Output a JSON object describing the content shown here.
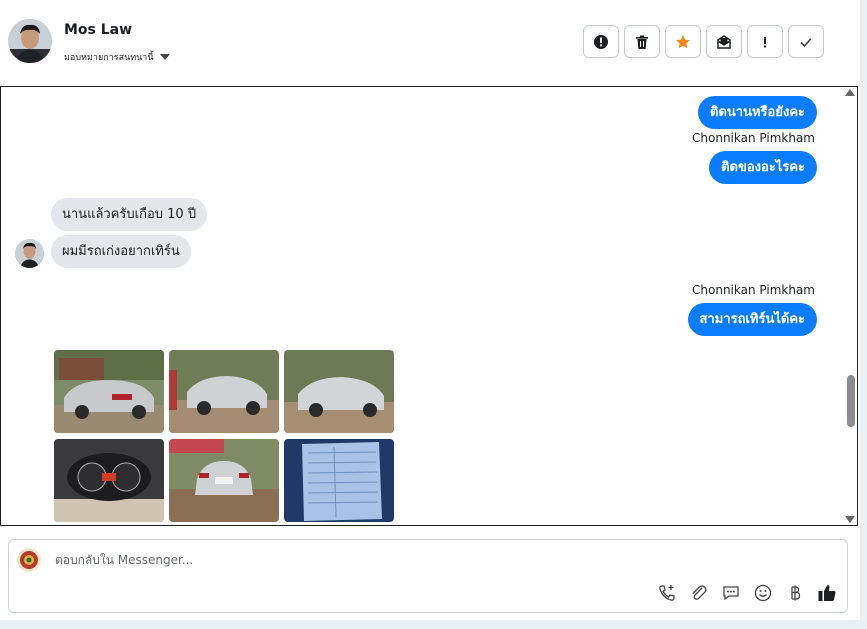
{
  "header": {
    "contact_name": "Mos Law",
    "assign_label": "มอบหมายการสนทนานี้",
    "actions": [
      {
        "icon": "alert-circle-icon",
        "name": "mark-spam-button"
      },
      {
        "icon": "trash-icon",
        "name": "delete-button"
      },
      {
        "icon": "star-icon",
        "name": "star-button"
      },
      {
        "icon": "mail-unread-icon",
        "name": "mark-unread-button"
      },
      {
        "icon": "exclamation-icon",
        "name": "follow-up-button"
      },
      {
        "icon": "check-icon",
        "name": "done-button"
      }
    ]
  },
  "messages": {
    "out_1": "ติดนานหรือยังคะ",
    "sender_1": "Chonnikan Pimkham",
    "out_2": "ติดของอะไรคะ",
    "in_1": "นานแล้วครับเกือบ 10 ปี",
    "in_2": "ผมมีรถเก่งอยากเทิร์น",
    "sender_2": "Chonnikan Pimkham",
    "out_3": "สามารถเทิร์นได้คะ"
  },
  "composer": {
    "placeholder": "ตอบกลับใน Messenger...",
    "tools": [
      "phone-add-icon",
      "attachment-icon",
      "saved-reply-icon",
      "emoji-icon",
      "baht-icon",
      "thumbs-up-icon"
    ]
  },
  "colors": {
    "outgoing_bubble": "#0a7cff",
    "incoming_bubble": "#e4e6eb",
    "star": "#f5871f"
  }
}
